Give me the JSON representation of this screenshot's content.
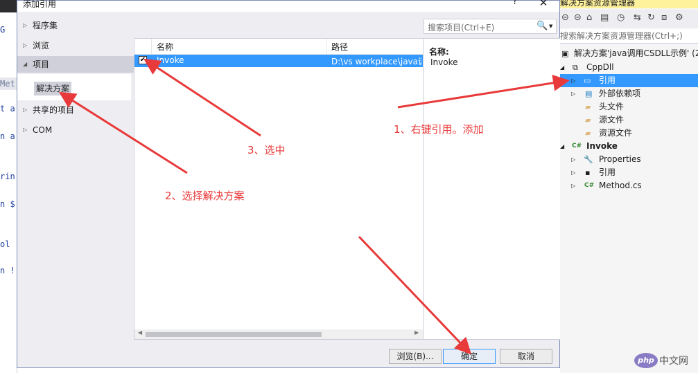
{
  "editor": {
    "fragments": [
      "G",
      "Met",
      "t a",
      "n a",
      "rin",
      "n $",
      "ol",
      "n !"
    ]
  },
  "dialog": {
    "title": "添加引用",
    "help": "?",
    "close": "✕",
    "nav": {
      "items": [
        {
          "label": "程序集",
          "arrow": "▷"
        },
        {
          "label": "浏览",
          "arrow": "▷"
        },
        {
          "label": "项目",
          "arrow": "◢"
        },
        {
          "label": "共享的项目",
          "arrow": "▷"
        },
        {
          "label": "COM",
          "arrow": "▷"
        }
      ],
      "sub_item": "解决方案"
    },
    "search": {
      "placeholder": "搜索项目(Ctrl+E)",
      "icon": "🔍",
      "dropdown": "▼"
    },
    "list": {
      "columns": [
        "名称",
        "路径"
      ],
      "rows": [
        {
          "checked": "✔",
          "name": "Invoke",
          "path": "D:\\vs workplace\\java调"
        }
      ]
    },
    "details": {
      "label": "名称:",
      "value": "Invoke"
    },
    "buttons": {
      "browse": "浏览(B)...",
      "ok": "确定",
      "cancel": "取消"
    }
  },
  "solution_explorer": {
    "title": "解决方案资源管理器",
    "search_placeholder": "搜索解决方案资源管理器(Ctrl+;)",
    "toolbar_icons": [
      "back-icon",
      "forward-icon",
      "home-icon",
      "switch-views-icon",
      "history-icon",
      "sync-icon",
      "properties-icon"
    ],
    "tree": [
      {
        "text": "解决方案'java调用CSDLL示例' (2",
        "icon": "▣",
        "indent": 0,
        "expander": ""
      },
      {
        "text": "CppDll",
        "icon": "⧉",
        "indent": 1,
        "expander": "◢"
      },
      {
        "text": "引用",
        "icon": "▭",
        "indent": 2,
        "expander": "▷",
        "selected": true
      },
      {
        "text": "外部依赖项",
        "icon": "▤",
        "indent": 2,
        "expander": "▷"
      },
      {
        "text": "头文件",
        "icon": "▰",
        "indent": 2,
        "expander": ""
      },
      {
        "text": "源文件",
        "icon": "▰",
        "indent": 2,
        "expander": ""
      },
      {
        "text": "资源文件",
        "icon": "▰",
        "indent": 2,
        "expander": ""
      },
      {
        "text": "Invoke",
        "icon": "C#",
        "indent": 1,
        "expander": "◢",
        "bold": true
      },
      {
        "text": "Properties",
        "icon": "🔧",
        "indent": 2,
        "expander": "▷"
      },
      {
        "text": "引用",
        "icon": "▪",
        "indent": 2,
        "expander": "▷"
      },
      {
        "text": "Method.cs",
        "icon": "C#",
        "indent": 2,
        "expander": "▷"
      }
    ]
  },
  "annotations": {
    "step1": "1、右键引用。添加",
    "step2": "2、选择解决方案",
    "step3": "3、选中",
    "color": "#e83a3a"
  },
  "watermark": {
    "logo": "php",
    "text": "中文网"
  }
}
